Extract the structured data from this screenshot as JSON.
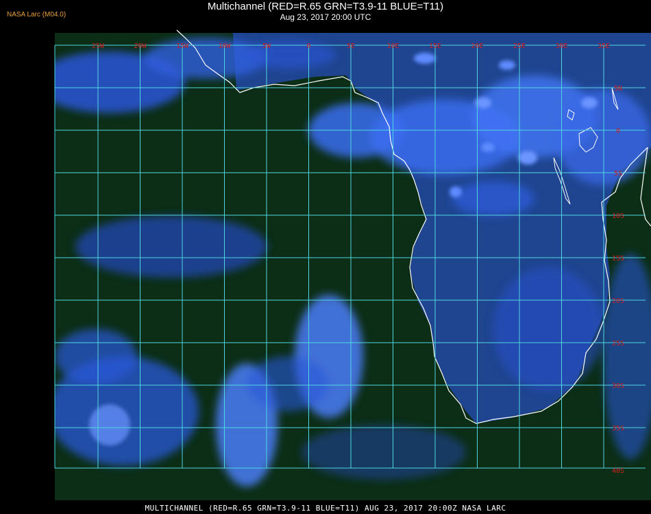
{
  "header": {
    "credit": "NASA Larc (M04.0)",
    "title": "Multichannel (RED=R.65 GRN=T3.9-11 BLUE=T11)",
    "subtitle": "Aug 23, 2017 20:00 UTC"
  },
  "footer": {
    "caption": "MULTICHANNEL (RED=R.65 GRN=T3.9-11 BLUE=T11) AUG 23, 2017 20:00Z  NASA LARC"
  },
  "map": {
    "longitude_labels": [
      "25W",
      "20W",
      "15W",
      "10W",
      "5W",
      "0",
      "5E",
      "10E",
      "15E",
      "20E",
      "25E",
      "30E",
      "35E"
    ],
    "latitude_labels": [
      "5N",
      "0",
      "5S",
      "10S",
      "15S",
      "20S",
      "25S",
      "30S",
      "35S",
      "40S"
    ],
    "colors": {
      "grid": "#4fd6e0",
      "coast": "#ffffff",
      "label": "#d02020",
      "ocean": "#0c2e16",
      "cloud": "#2d5ae8",
      "land": "#1c3a7a"
    }
  }
}
